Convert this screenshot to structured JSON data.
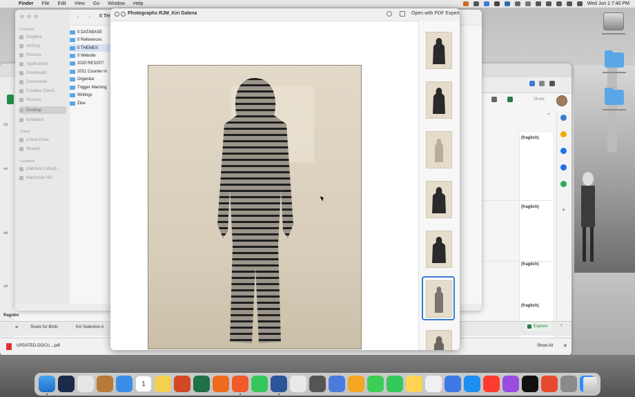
{
  "menubar": {
    "app": "Finder",
    "items": [
      "File",
      "Edit",
      "View",
      "Go",
      "Window",
      "Help"
    ],
    "clock": "Wed Jun 1  7:40 PM"
  },
  "finder": {
    "breadcrumb": "0 TH",
    "sidebar": {
      "favorites_header": "Favorites",
      "favorites": [
        "Dropbox",
        "AirDrop",
        "Recents",
        "Applications",
        "Downloads",
        "Documents",
        "Creative Cloud...",
        "Pictures",
        "Desktop",
        "kiridalena"
      ],
      "selected_favorite": "Desktop",
      "icloud_header": "iCloud",
      "icloud": [
        "iCloud Drive",
        "Shared"
      ],
      "locations_header": "Locations",
      "locations": [
        "Gabriela's MacB...",
        "Macintosh HD"
      ]
    },
    "files": [
      "0 DATABASE",
      "0 References",
      "0 THEMES",
      "0 Website",
      "2020 RESIST!",
      "2021 Counter In",
      "Organize",
      "Trigger Warning",
      "Writings",
      "Zine"
    ],
    "selected_file": "0 THEMES"
  },
  "preview": {
    "title": "Photographs RJM_Kiri Dalena",
    "open_label": "Open with PDF Expert",
    "thumbnail_count": 7,
    "selected_thumbnail": 6
  },
  "browser": {
    "share_label": "Share",
    "cell_texts": [
      "(fraglich)",
      "(fraglich)",
      "(fraglich)",
      "(fraglich)"
    ],
    "row_labels": [
      "Q2",
      "ein",
      "ahl",
      "ahl",
      "Ragobo"
    ],
    "sheet_tabs": [
      "Snare for Birds",
      "Kiri Selection A"
    ],
    "explore_label": "Explore",
    "download_file": "UPDATED-DOCU....pdf",
    "show_all": "Show All",
    "close_glyph": "✕"
  },
  "dock": {
    "calendar_day": "1"
  },
  "colors": {
    "accent": "#3a7bd5",
    "folder": "#5aa7e8",
    "sheets_green": "#1f8f48"
  }
}
